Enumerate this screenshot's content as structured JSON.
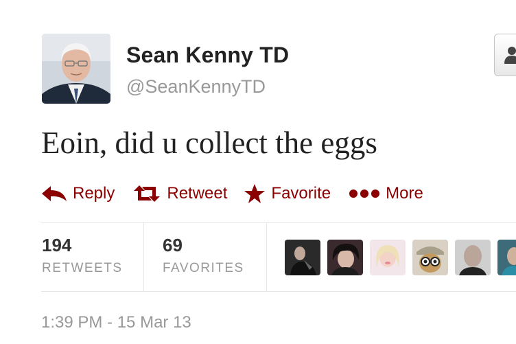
{
  "user": {
    "display_name": "Sean Kenny TD",
    "screen_name": "@SeanKennyTD",
    "avatar_icon": "profile-photo"
  },
  "follow_button": {
    "icon": "follow-person-icon"
  },
  "tweet": {
    "text": "Eoin, did u collect the eggs",
    "timestamp": "1:39 PM - 15 Mar 13"
  },
  "actions": [
    {
      "label": "Reply",
      "icon": "reply-arrow-icon"
    },
    {
      "label": "Retweet",
      "icon": "retweet-icon"
    },
    {
      "label": "Favorite",
      "icon": "star-icon"
    },
    {
      "label": "More",
      "icon": "more-dots-icon"
    }
  ],
  "stats": {
    "retweets": {
      "value": "194",
      "label": "RETWEETS"
    },
    "favorites": {
      "value": "69",
      "label": "FAVORITES"
    }
  },
  "favoriters": [
    {
      "icon": "favoriter-avatar"
    },
    {
      "icon": "favoriter-avatar"
    },
    {
      "icon": "favoriter-avatar"
    },
    {
      "icon": "favoriter-avatar"
    },
    {
      "icon": "favoriter-avatar"
    },
    {
      "icon": "favoriter-avatar"
    }
  ],
  "colors": {
    "action": "#8b0000",
    "text": "#222222",
    "muted": "#999999",
    "divider": "#e6e6e6"
  }
}
